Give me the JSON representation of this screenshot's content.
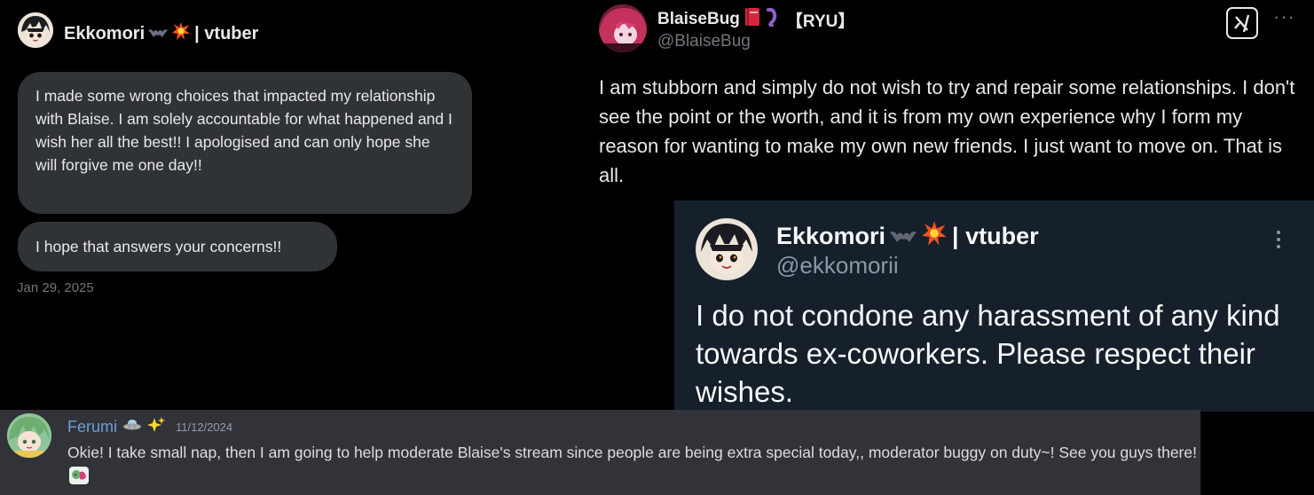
{
  "dm_panel": {
    "sender_name": "Ekkomori",
    "sender_suffix": "| vtuber",
    "message_1": "I made some wrong choices that impacted my relationship with Blaise. I am solely accountable for what happened and I wish her all the best!! I apologised and can only hope she will forgive me one day!!",
    "message_2": "I hope that answers your concerns!!",
    "date": "Jan 29, 2025",
    "icons": [
      "bat-emoji-icon",
      "collision-emoji-icon"
    ]
  },
  "blaise_post": {
    "display_name": "BlaiseBug",
    "name_suffix": "【RYU】",
    "handle": "@BlaiseBug",
    "text": "I am stubborn and simply do not wish to try and repair some relationships. I don't see the point or the worth, and it is from my own experience why I form my reason for wanting to make my own new friends. I just want to move on. That is all.",
    "icons": [
      "red-book-emoji-icon",
      "purple-worm-emoji-icon",
      "grok-icon",
      "more-options-icon"
    ]
  },
  "ekko_post": {
    "display_name": "Ekkomori",
    "name_suffix": "| vtuber",
    "handle": "@ekkomorii",
    "text": "I do not condone any harassment of any kind towards ex-coworkers. Please respect their wishes.",
    "icons": [
      "bat-emoji-icon",
      "collision-emoji-icon",
      "more-options-icon"
    ]
  },
  "discord_message": {
    "username": "Ferumi",
    "timestamp": "11/12/2024",
    "text": "Okie! I take small nap, then I am going to help moderate Blaise's stream since people are being extra special today,, moderator buggy on duty~! See you guys there!",
    "icons": [
      "ufo-emoji-icon",
      "sparkles-emoji-icon",
      "sticker-emoji-icon"
    ]
  },
  "colors": {
    "x_black": "#000000",
    "dm_bubble": "#2f3336",
    "dim_bg": "#15202b",
    "discord_bg": "#313338",
    "discord_username": "#6f9dd6"
  }
}
